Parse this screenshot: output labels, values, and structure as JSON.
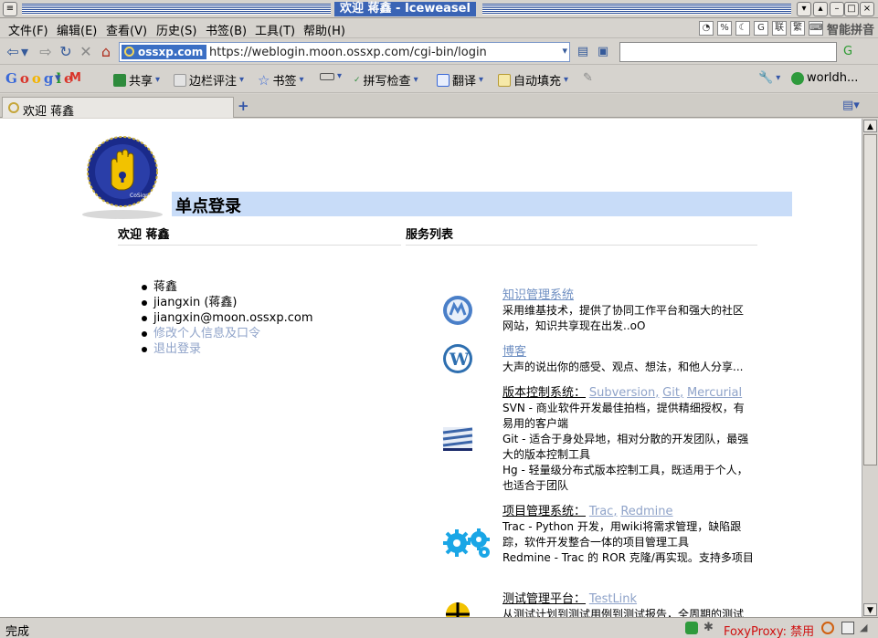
{
  "window": {
    "title": "欢迎 蒋鑫 - Iceweasel"
  },
  "menu": [
    "文件(F)",
    "编辑(E)",
    "查看(V)",
    "历史(S)",
    "书签(B)",
    "工具(T)",
    "帮助(H)"
  ],
  "ime": {
    "label": "智能拼音",
    "icons": [
      "联",
      "繁"
    ]
  },
  "nav": {
    "site_badge": "ossxp.com",
    "url": "https://weblogin.moon.ossxp.com/cgi-bin/login",
    "search_value": ""
  },
  "google_bar": {
    "logo": "Google",
    "items": [
      "共享",
      "边栏评注",
      "书签",
      "拼写检查",
      "翻译",
      "自动填充"
    ],
    "right_label": "worldh..."
  },
  "tab": {
    "label": "欢迎 蒋鑫",
    "new_tab": "+"
  },
  "page": {
    "banner_title": "单点登录",
    "left_heading": "欢迎 蒋鑫",
    "right_heading": "服务列表",
    "user_info": [
      "蒋鑫",
      "jiangxin (蒋鑫)",
      "jiangxin@moon.ossxp.com"
    ],
    "user_links": [
      "修改个人信息及口令",
      "退出登录"
    ],
    "services": [
      {
        "name": "知识管理系统",
        "desc": "采用维基技术，提供了协同工作平台和强大的社区网站，知识共享现在出发..oO"
      },
      {
        "name": "博客",
        "desc": "大声的说出你的感受、观点、想法，和他人分享..."
      },
      {
        "lead": "版本控制系统：",
        "links": [
          "Subversion",
          "Git",
          "Mercurial"
        ],
        "lines": [
          "SVN - 商业软件开发最佳拍档，提供精细授权，有易用的客户端",
          "Git - 适合于身处异地，相对分散的开发团队，最强大的版本控制工具",
          "Hg - 轻量级分布式版本控制工具，既适用于个人，也适合于团队"
        ]
      },
      {
        "lead": "项目管理系统：",
        "links": [
          "Trac",
          "Redmine"
        ],
        "lines": [
          "Trac - Python 开发，用wiki将需求管理，缺陷跟踪，软件开发整合一体的项目管理工具",
          "Redmine - Trac 的 ROR 克隆/再实现。支持多项目"
        ]
      },
      {
        "lead": "测试管理平台：",
        "links": [
          "TestLink"
        ],
        "lines": [
          "从测试计划到测试用例到测试报告，全周期的测试"
        ]
      }
    ]
  },
  "status": {
    "text": "完成",
    "foxyproxy": "FoxyProxy: 禁用"
  },
  "colors": {
    "banner": "#c8dcf8",
    "link": "#8fa3c9",
    "service_link": "#6f8fc2",
    "foxy": "#d01010"
  }
}
